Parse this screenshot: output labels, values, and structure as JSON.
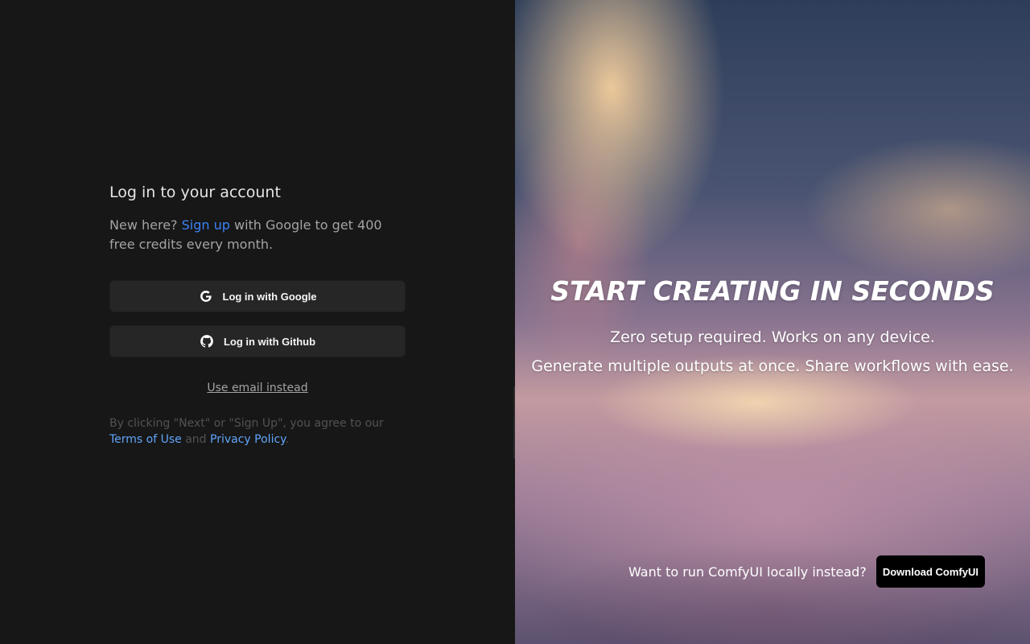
{
  "login": {
    "title": "Log in to your account",
    "subtitle_prefix": "New here? ",
    "signup_link": "Sign up",
    "subtitle_suffix": " with Google to get 400 free credits every month.",
    "google_button": "Log in with Google",
    "github_button": "Log in with Github",
    "email_link": "Use email instead",
    "terms_prefix": "By clicking \"Next\" or \"Sign Up\", you agree to our ",
    "terms_link": "Terms of Use",
    "terms_and": " and ",
    "privacy_link": "Privacy Policy",
    "terms_suffix": "."
  },
  "hero": {
    "title": "START CREATING IN SECONDS",
    "line1": "Zero setup required. Works on any device.",
    "line2": "Generate multiple outputs at once. Share workflows with ease.",
    "local_prompt": "Want to run ComfyUI locally instead?",
    "download_button": "Download ComfyUI"
  },
  "colors": {
    "left_bg": "#171717",
    "link_blue": "#3b82f6",
    "button_bg": "#262626"
  },
  "icons": {
    "google": "google-icon",
    "github": "github-icon"
  }
}
